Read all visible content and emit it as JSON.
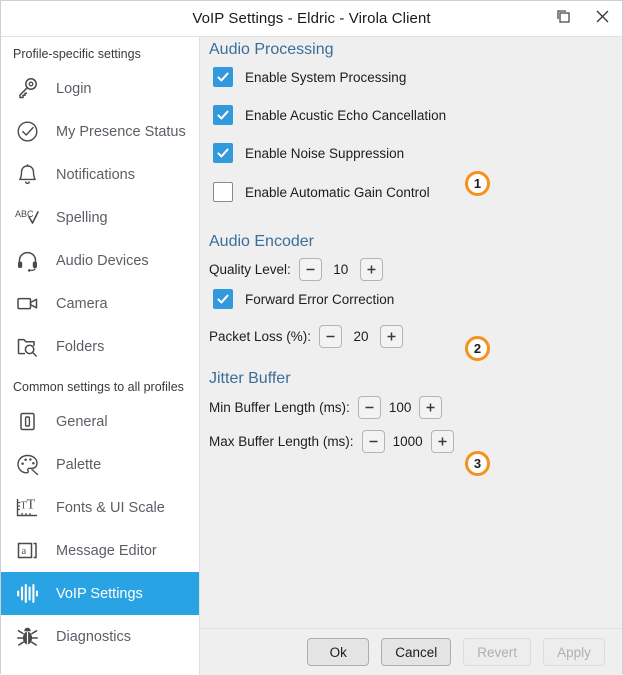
{
  "window": {
    "title": "VoIP Settings - Eldric - Virola Client",
    "restore_icon": "restore-window-icon",
    "close_icon": "close-icon"
  },
  "theme": {
    "accent_blue": "#29a3e3",
    "checkbox_blue": "#3399dd",
    "section_heading": "#3a6e99",
    "badge_orange": "#f5921e",
    "panel_bg": "#efefef",
    "sidebar_bg": "#ffffff"
  },
  "sidebar": {
    "group1_label": "Profile-specific settings",
    "group2_label": "Common settings to all profiles",
    "group1_items": [
      {
        "label": "Login",
        "icon": "key-icon",
        "selected": false
      },
      {
        "label": "My Presence Status",
        "icon": "check-circle-icon",
        "selected": false
      },
      {
        "label": "Notifications",
        "icon": "bell-icon",
        "selected": false
      },
      {
        "label": "Spelling",
        "icon": "spellcheck-abc-icon",
        "selected": false
      },
      {
        "label": "Audio Devices",
        "icon": "headset-icon",
        "selected": false
      },
      {
        "label": "Camera",
        "icon": "video-camera-icon",
        "selected": false
      },
      {
        "label": "Folders",
        "icon": "folder-search-icon",
        "selected": false
      }
    ],
    "group2_items": [
      {
        "label": "General",
        "icon": "general-settings-icon",
        "selected": false
      },
      {
        "label": "Palette",
        "icon": "palette-icon",
        "selected": false
      },
      {
        "label": "Fonts & UI Scale",
        "icon": "font-scale-icon",
        "selected": false
      },
      {
        "label": "Message Editor",
        "icon": "message-editor-icon",
        "selected": false
      },
      {
        "label": "VoIP Settings",
        "icon": "audio-waveform-icon",
        "selected": true
      },
      {
        "label": "Diagnostics",
        "icon": "bug-icon",
        "selected": false
      }
    ]
  },
  "main": {
    "audio_processing": {
      "heading": "Audio Processing",
      "badge": "1",
      "checkboxes": [
        {
          "label": "Enable System Processing",
          "checked": true
        },
        {
          "label": "Enable Acustic Echo Cancellation",
          "checked": true
        },
        {
          "label": "Enable Noise Suppression",
          "checked": true
        },
        {
          "label": "Enable Automatic Gain Control",
          "checked": false
        }
      ]
    },
    "audio_encoder": {
      "heading": "Audio Encoder",
      "badge": "2",
      "quality_label": "Quality Level:",
      "quality_value": "10",
      "fec_label": "Forward Error Correction",
      "fec_checked": true,
      "packet_loss_label": "Packet Loss (%):",
      "packet_loss_value": "20"
    },
    "jitter_buffer": {
      "heading": "Jitter Buffer",
      "badge": "3",
      "min_label": "Min Buffer Length (ms):",
      "min_value": "100",
      "max_label": "Max Buffer Length (ms):",
      "max_value": "1000"
    },
    "stepper_minus": "−",
    "stepper_plus": "+"
  },
  "footer": {
    "ok": "Ok",
    "cancel": "Cancel",
    "revert": "Revert",
    "apply": "Apply"
  }
}
